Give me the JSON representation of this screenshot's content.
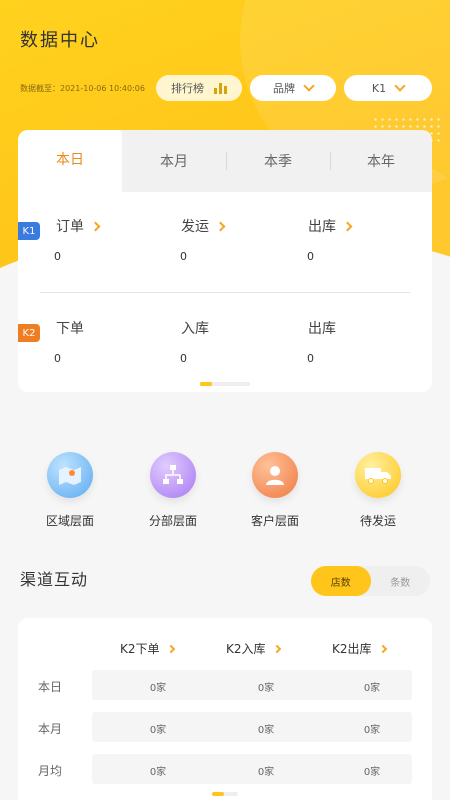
{
  "header": {
    "title": "数据中心",
    "stat_date": "数据截至：2021-10-06 10:40:06",
    "rank_label": "排行榜",
    "brand_label": "品牌",
    "k1_label": "K1"
  },
  "tabs": [
    {
      "label": "本日"
    },
    {
      "label": "本月"
    },
    {
      "label": "本季"
    },
    {
      "label": "本年"
    }
  ],
  "k1": {
    "badge": "K1",
    "metrics": [
      {
        "label": "订单",
        "value": "0"
      },
      {
        "label": "发运",
        "value": "0"
      },
      {
        "label": "出库",
        "value": "0"
      }
    ]
  },
  "k2": {
    "badge": "K2",
    "metrics": [
      {
        "label": "下单",
        "value": "0"
      },
      {
        "label": "入库",
        "value": "0"
      },
      {
        "label": "出库",
        "value": "0"
      }
    ]
  },
  "quick_links": [
    {
      "label": "区域层面",
      "icon": "map-icon"
    },
    {
      "label": "分部层面",
      "icon": "org-chart-icon"
    },
    {
      "label": "客户层面",
      "icon": "user-icon"
    },
    {
      "label": "待发运",
      "icon": "truck-icon"
    }
  ],
  "channel": {
    "title": "渠道互动",
    "toggle": [
      "店数",
      "条数"
    ],
    "columns": [
      "K2下单",
      "K2入库",
      "K2出库"
    ],
    "rows": [
      {
        "label": "本日",
        "cells": [
          "0家",
          "0家",
          "0家"
        ]
      },
      {
        "label": "本月",
        "cells": [
          "0家",
          "0家",
          "0家"
        ]
      },
      {
        "label": "月均",
        "cells": [
          "0家",
          "0家",
          "0家"
        ]
      }
    ]
  },
  "colors": {
    "brand_yellow": "#ffc51a",
    "accent_orange": "#e98a1d",
    "k1_blue": "#3a7be0",
    "k2_orange": "#ef7d22"
  }
}
